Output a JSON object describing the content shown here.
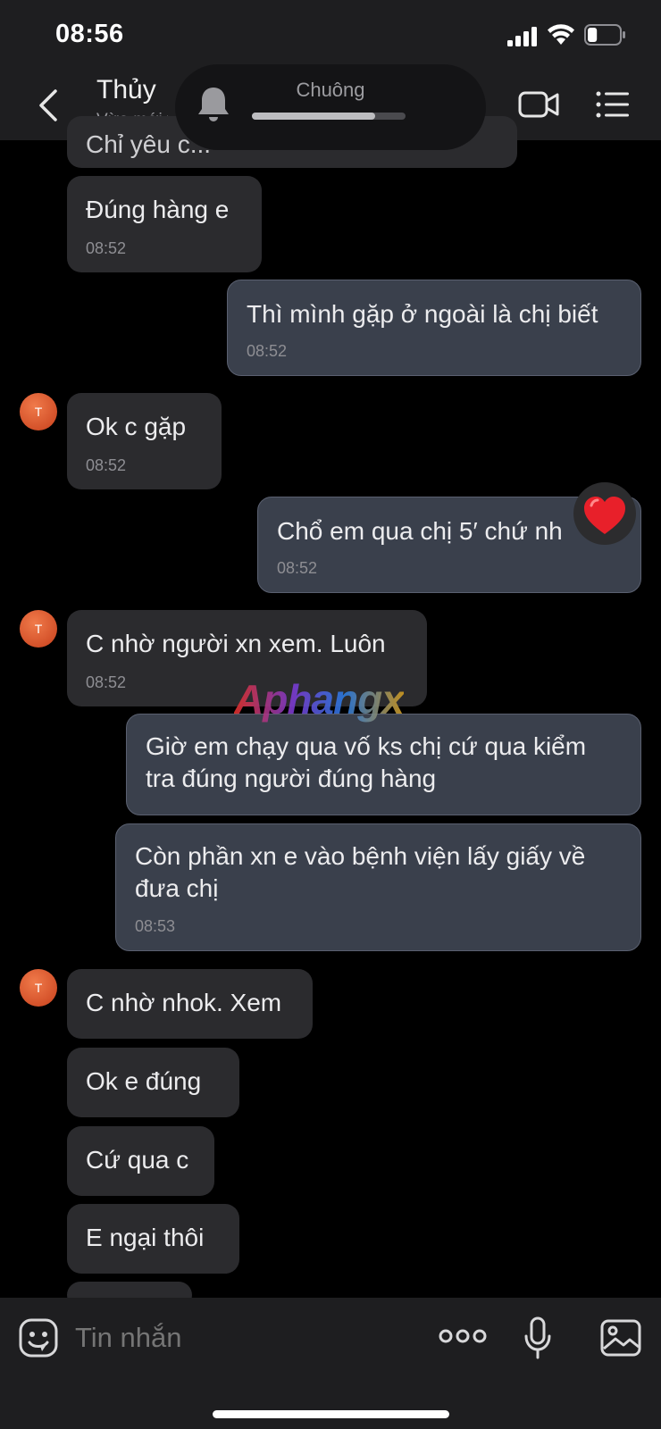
{
  "status_bar": {
    "time": "08:56",
    "battery_level": 0.3
  },
  "header": {
    "contact_name": "Thủy",
    "contact_status": "Vừa mới truy cập"
  },
  "ringtone": {
    "label": "Chuông",
    "level": 0.8
  },
  "messages": [
    {
      "text": "Chỉ yêu c...",
      "time": ""
    },
    {
      "text": "Đúng hàng e",
      "time": "08:52"
    },
    {
      "text": "Thì mình gặp ở ngoài là chị biết",
      "time": "08:52"
    },
    {
      "avatar": "T",
      "text": "Ok c gặp",
      "time": "08:52"
    },
    {
      "text": "Chổ em qua chị 5′ chứ nh",
      "time": "08:52",
      "reaction": "heart"
    },
    {
      "avatar": "T",
      "text": "C nhờ người xn xem. Luôn",
      "time": "08:52"
    },
    {
      "text_line1": "Giờ em chạy qua vố ks chị cứ qua kiểm",
      "text_line2": "tra đúng người đúng hàng"
    },
    {
      "text_line1": "Còn phần xn e vào bệnh viện lấy giấy về",
      "text_line2": "đưa chị",
      "time": "08:53"
    },
    {
      "avatar": "T",
      "text": "C nhờ nhok. Xem"
    },
    {
      "text": "Ok e đúng"
    },
    {
      "text": "Cứ qua c"
    },
    {
      "text": "E ngại thôi"
    }
  ],
  "watermark": "Aphangx",
  "composer": {
    "placeholder": "Tin nhắn"
  },
  "colors": {
    "incoming_bubble": "#2b2b2e",
    "outgoing_bubble": "#3a404c",
    "avatar": "#e0552a",
    "heart": "#e8202a"
  }
}
